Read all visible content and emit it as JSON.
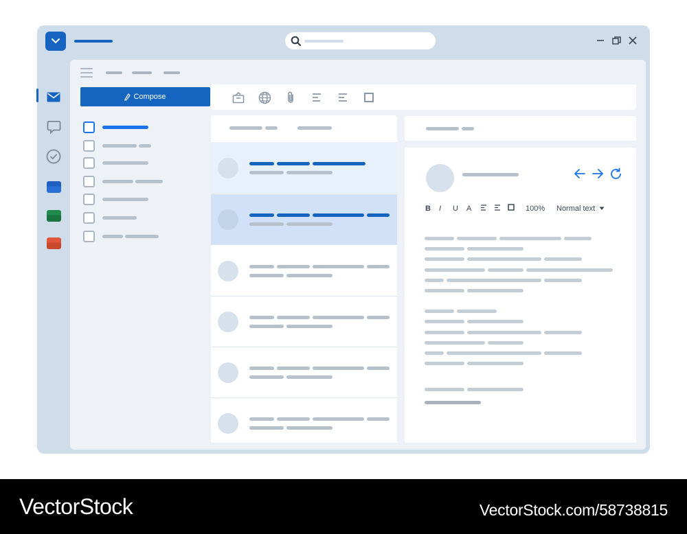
{
  "app": {
    "logo_icon": "chevron-down-icon",
    "accent_color": "#1565c0",
    "link_color": "#1a73e8"
  },
  "search": {
    "placeholder": ""
  },
  "window_controls": [
    "minimize-icon",
    "restore-icon",
    "close-icon"
  ],
  "rail": {
    "items": [
      {
        "name": "mail",
        "icon": "mail-icon",
        "active": true
      },
      {
        "name": "chat",
        "icon": "chat-icon"
      },
      {
        "name": "tasks",
        "icon": "check-circle-icon"
      },
      {
        "name": "blue-folder",
        "color": "#1e5fbf"
      },
      {
        "name": "green-folder",
        "color": "#1f8a4c"
      },
      {
        "name": "red-folder",
        "color": "#d9533a"
      }
    ]
  },
  "compose": {
    "label": "Compose",
    "icon": "pen-icon"
  },
  "toolbar": {
    "icons": [
      "archive-icon",
      "globe-icon",
      "attachment-icon",
      "align-left-icon",
      "align-justify-icon",
      "square-icon"
    ]
  },
  "editor": {
    "format_buttons": [
      "B",
      "I",
      "U",
      "A"
    ],
    "zoom": "100%",
    "text_style": "Normal text"
  },
  "watermark": {
    "brand": "VectorStock",
    "url": "VectorStock.com/58738815"
  }
}
